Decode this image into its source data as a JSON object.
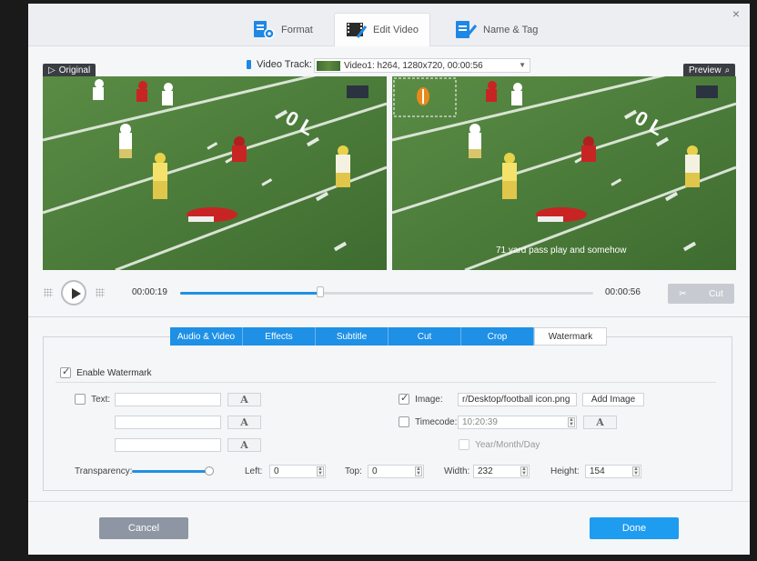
{
  "window": {
    "tabs": [
      {
        "label": "Format",
        "active": false
      },
      {
        "label": "Edit Video",
        "active": true
      },
      {
        "label": "Name & Tag",
        "active": false
      }
    ],
    "close_symbol": "×"
  },
  "video_track": {
    "label": "Video Track:",
    "selected": "Video1: h264, 1280x720, 00:00:56"
  },
  "preview": {
    "original_label": "Original",
    "preview_label": "Preview",
    "caption": "71 yard pass play and somehow"
  },
  "playback": {
    "current_time": "00:00:19",
    "total_time": "00:00:56",
    "progress": 0.34,
    "cut_label": "Cut"
  },
  "subtabs": [
    {
      "label": "Audio & Video",
      "active": false
    },
    {
      "label": "Effects",
      "active": false
    },
    {
      "label": "Subtitle",
      "active": false
    },
    {
      "label": "Cut",
      "active": false
    },
    {
      "label": "Crop",
      "active": false
    },
    {
      "label": "Watermark",
      "active": true
    }
  ],
  "watermark": {
    "enable_label": "Enable Watermark",
    "enable_checked": true,
    "text_label": "Text:",
    "text_checked": false,
    "text_values": [
      "",
      "",
      ""
    ],
    "font_button": "A",
    "image_label": "Image:",
    "image_checked": true,
    "image_path": "r/Desktop/football icon.png",
    "add_image_label": "Add Image",
    "timecode_label": "Timecode:",
    "timecode_checked": false,
    "timecode_value": "10:20:39",
    "date_label": "Year/Month/Day",
    "transparency_label": "Transparency:",
    "transparency_value": 1.0,
    "left_label": "Left:",
    "left_value": "0",
    "top_label": "Top:",
    "top_value": "0",
    "width_label": "Width:",
    "width_value": "232",
    "height_label": "Height:",
    "height_value": "154"
  },
  "footer": {
    "cancel_label": "Cancel",
    "done_label": "Done"
  },
  "colors": {
    "accent": "#1e90e6",
    "done": "#1e9cf0",
    "cancel": "#8e96a3",
    "field": "#4c7a3b"
  },
  "icons": [
    "format-icon",
    "edit-video-icon",
    "name-tag-icon",
    "close-icon",
    "play-icon",
    "scissors-icon",
    "search-icon",
    "triangle-icon"
  ]
}
